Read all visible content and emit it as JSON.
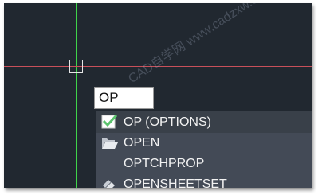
{
  "command_line": {
    "typed_text": "OP"
  },
  "autocomplete": {
    "items": [
      {
        "label": "OP (OPTIONS)",
        "icon": "checkmark-icon",
        "selected": true
      },
      {
        "label": "OPEN",
        "icon": "folder-open-icon",
        "selected": false
      },
      {
        "label": "OPTCHPROP",
        "icon": "",
        "selected": false
      },
      {
        "label": "OPENSHEETSET",
        "icon": "sheet-set-icon",
        "selected": false
      }
    ]
  },
  "watermark": {
    "text": "CAD自学网 www.cadzxw.com"
  },
  "colors": {
    "canvas_background": "#212830",
    "crosshair_vertical": "#3fd44a",
    "crosshair_horizontal": "#c8505a",
    "list_background": "#434a56",
    "checkmark": "#5cc36e"
  }
}
